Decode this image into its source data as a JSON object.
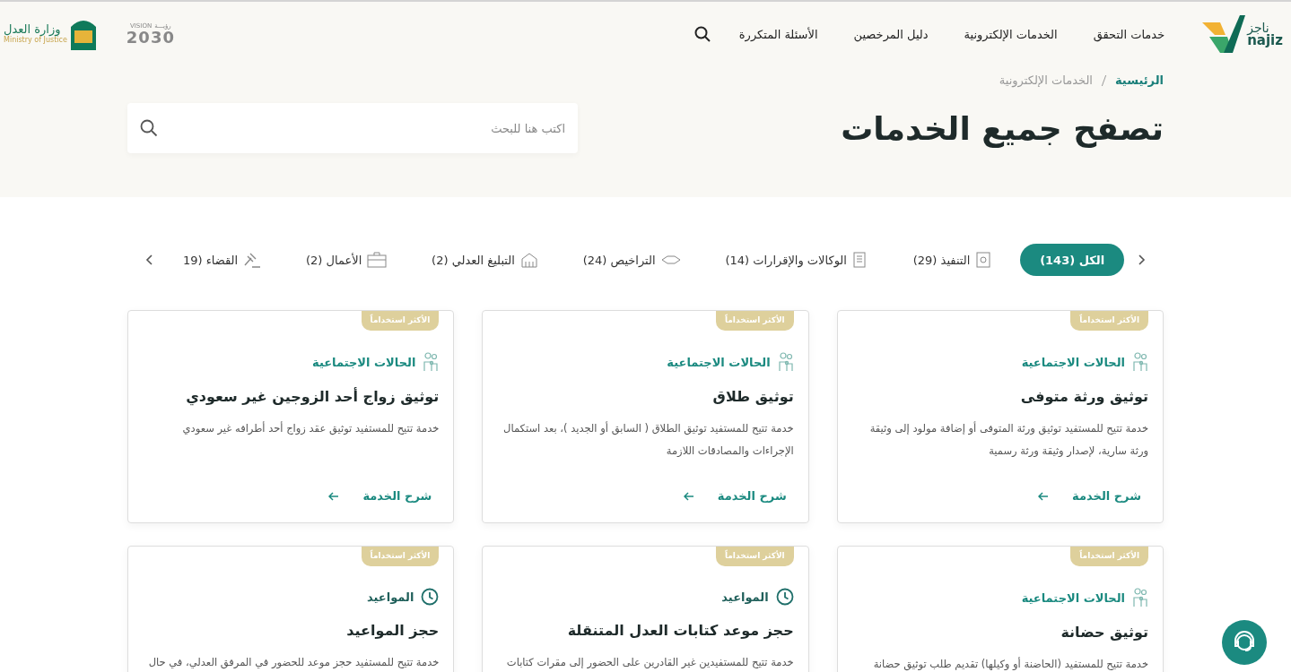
{
  "header": {
    "logo": {
      "arabic": "ناجز",
      "latin": "najiz"
    },
    "nav": [
      "خدمات التحقق",
      "الخدمات الإلكترونية",
      "دليل المرخصين",
      "الأسئلة المتكررة"
    ],
    "vision": {
      "arabic": "رؤيـــة",
      "latin": "VISION",
      "year": "2030"
    },
    "ministry": {
      "arabic": "وزارة العدل",
      "latin": "Ministry of Justice"
    }
  },
  "breadcrumb": [
    {
      "label": "الرئيسية",
      "current": false
    },
    {
      "label": "الخدمات الإلكترونية",
      "current": true
    }
  ],
  "page_title": "تصفح جميع الخدمات",
  "search": {
    "placeholder": "اكتب هنا للبحث"
  },
  "tabs": [
    {
      "label": "الكل (143)",
      "kind": "all",
      "selected": true
    },
    {
      "label": "التنفيذ (29)",
      "kind": "execution",
      "selected": false
    },
    {
      "label": "الوكالات والإقرارات (14)",
      "kind": "agency",
      "selected": false
    },
    {
      "label": "التراخيص (24)",
      "kind": "license",
      "selected": false
    },
    {
      "label": "التبليغ العدلي (2)",
      "kind": "notify",
      "selected": false
    },
    {
      "label": "الأعمال (2)",
      "kind": "business",
      "selected": false
    },
    {
      "label": "القضاء (19",
      "kind": "judiciary",
      "selected": false
    }
  ],
  "cards": [
    {
      "badge": "الأكثر استخداماً",
      "category": {
        "label": "الحالات الاجتماعية",
        "kind": "social"
      },
      "title": "توثيق ورثة متوفى",
      "description": "خدمة تتيح للمستفيد توثيق ورثة المتوفى أو إضافة مولود إلى وثيقة ورثة سارية، لإصدار وثيقة ورثة رسمية",
      "link": "شرح الخدمة"
    },
    {
      "badge": "الأكثر استخداماً",
      "category": {
        "label": "الحالات الاجتماعية",
        "kind": "social"
      },
      "title": "توثيق طلاق",
      "description": "خدمة تتيح للمستفيد توثيق الطلاق ( السابق أو الجديد )، بعد استكمال الإجراءات والمصادقات اللازمة",
      "link": "شرح الخدمة"
    },
    {
      "badge": "الأكثر استخداماً",
      "category": {
        "label": "الحالات الاجتماعية",
        "kind": "social"
      },
      "title": "توثيق زواج أحد الزوجين غير سعودي",
      "description": "خدمة تتيح للمستفيد توثيق عقد زواج أحد أطرافه غير سعودي",
      "link": "شرح الخدمة"
    },
    {
      "badge": "الأكثر استخداماً",
      "category": {
        "label": "الحالات الاجتماعية",
        "kind": "social"
      },
      "title": "توثيق حضانة",
      "description": "خدمة تتيح للمستفيد (الحاضنة أو وكيلها) تقديم طلب توثيق حضانة"
    },
    {
      "badge": "الأكثر استخداماً",
      "category": {
        "label": "المواعيد",
        "kind": "appointments"
      },
      "title": "حجز موعد كتابات العدل المتنقلة",
      "description": "خدمة تتيح للمستفيدين غير القادرين على الحضور إلى مقرات كتابات"
    },
    {
      "badge": "الأكثر استخداماً",
      "category": {
        "label": "المواعيد",
        "kind": "appointments"
      },
      "title": "حجز المواعيد",
      "description": "خدمة تتيح للمستفيد حجز موعد للحضور في المرفق العدلي، في حال"
    }
  ]
}
